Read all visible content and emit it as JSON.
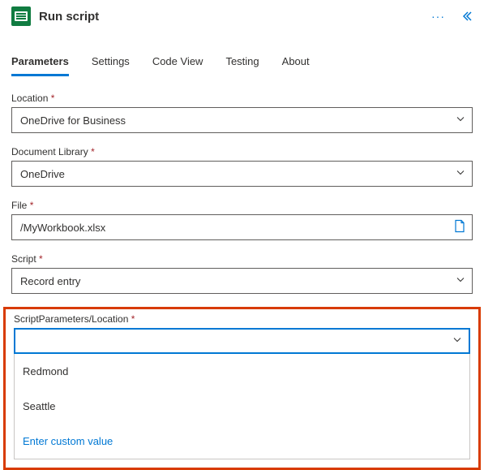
{
  "header": {
    "title": "Run script"
  },
  "tabs": {
    "parameters": "Parameters",
    "settings": "Settings",
    "codeView": "Code View",
    "testing": "Testing",
    "about": "About"
  },
  "fields": {
    "location": {
      "label": "Location",
      "value": "OneDrive for Business"
    },
    "documentLibrary": {
      "label": "Document Library",
      "value": "OneDrive"
    },
    "file": {
      "label": "File",
      "value": "/MyWorkbook.xlsx"
    },
    "script": {
      "label": "Script",
      "value": "Record entry"
    },
    "scriptParamLocation": {
      "label": "ScriptParameters/Location",
      "value": ""
    }
  },
  "dropdown": {
    "option1": "Redmond",
    "option2": "Seattle",
    "custom": "Enter custom value"
  },
  "required": "*"
}
